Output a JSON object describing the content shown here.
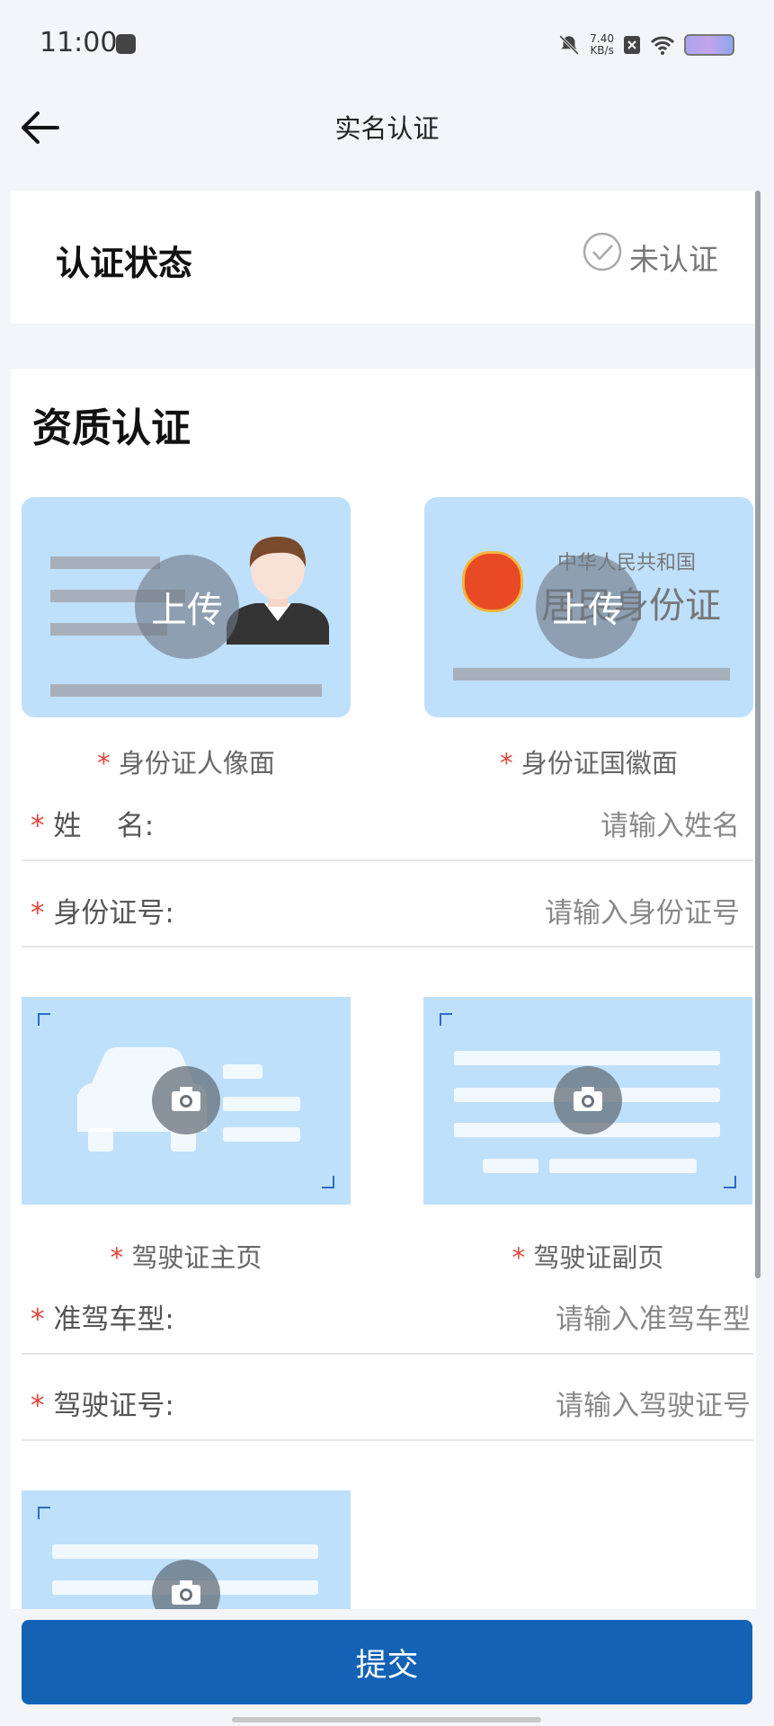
{
  "status_bar": {
    "time": "11:00",
    "net_speed": "7.40",
    "net_unit": "KB/s"
  },
  "header": {
    "title": "实名认证"
  },
  "auth_status": {
    "label": "认证状态",
    "value": "未认证"
  },
  "qualification": {
    "title": "资质认证",
    "id_front": {
      "upload": "上传",
      "caption": "身份证人像面"
    },
    "id_back": {
      "upload": "上传",
      "emblem_text_1": "中华人民共和国",
      "emblem_text_2": "居民身份证",
      "caption": "身份证国徽面"
    },
    "name_field": {
      "label": "姓    名:",
      "placeholder": "请输入姓名"
    },
    "idno_field": {
      "label": "身份证号:",
      "placeholder": "请输入身份证号"
    },
    "license_main": {
      "caption": "驾驶证主页"
    },
    "license_sub": {
      "caption": "驾驶证副页"
    },
    "vehicle_type_field": {
      "label": "准驾车型:",
      "placeholder": "请输入准驾车型"
    },
    "license_no_field": {
      "label": "驾驶证号:",
      "placeholder": "请输入驾驶证号"
    },
    "required_mark": "*"
  },
  "submit": {
    "label": "提交"
  },
  "colors": {
    "primary": "#1462b6",
    "required": "#e0463c",
    "image_bg": "#bfe0fb"
  }
}
